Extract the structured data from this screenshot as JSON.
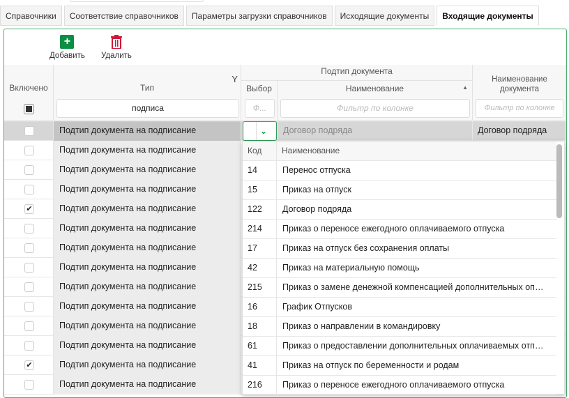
{
  "tabs": [
    "Справочники",
    "Соответствие справочников",
    "Параметры загрузки справочников",
    "Исходящие документы",
    "Входящие документы"
  ],
  "toolbar": {
    "add_label": "Добавить",
    "delete_label": "Удалить"
  },
  "colors": {
    "accent": "#0a8f43",
    "delete": "#d0193a",
    "border": "#4caf72"
  },
  "columns": {
    "enabled": "Включено",
    "type": "Тип",
    "subtype_group": "Подтип документа",
    "choice": "Выбор",
    "name": "Наименование",
    "doc_name": "Наименование документа"
  },
  "filters": {
    "type_value": "подписа",
    "choice_placeholder": "Ф...",
    "name_placeholder": "Фильтр по колонке",
    "doc_name_placeholder": "Фильтр по колонке"
  },
  "selected_row": {
    "type": "Подтип документа на подписание",
    "name": "Договор подряда",
    "doc_name": "Договор подряда"
  },
  "rows": [
    {
      "type": "Подтип документа на подписание",
      "checked": false
    },
    {
      "type": "Подтип документа на подписание",
      "checked": false
    },
    {
      "type": "Подтип документа на подписание",
      "checked": false
    },
    {
      "type": "Подтип документа на подписание",
      "checked": true
    },
    {
      "type": "Подтип документа на подписание",
      "checked": false
    },
    {
      "type": "Подтип документа на подписание",
      "checked": false
    },
    {
      "type": "Подтип документа на подписание",
      "checked": false
    },
    {
      "type": "Подтип документа на подписание",
      "checked": false
    },
    {
      "type": "Подтип документа на подписание",
      "checked": false
    },
    {
      "type": "Подтип документа на подписание",
      "checked": false
    },
    {
      "type": "Подтип документа на подписание",
      "checked": false
    },
    {
      "type": "Подтип документа на подписание",
      "checked": true
    },
    {
      "type": "Подтип документа на подписание",
      "checked": false
    }
  ],
  "dropdown": {
    "code_header": "Код",
    "name_header": "Наименование",
    "items": [
      {
        "code": "14",
        "name": "Перенос отпуска"
      },
      {
        "code": "15",
        "name": "Приказ на отпуск"
      },
      {
        "code": "122",
        "name": "Договор подряда"
      },
      {
        "code": "214",
        "name": "Приказ о переносе ежегодного оплачиваемого отпуска"
      },
      {
        "code": "17",
        "name": "Приказ на отпуск без сохранения оплаты"
      },
      {
        "code": "42",
        "name": "Приказ на материальную помощь"
      },
      {
        "code": "215",
        "name": "Приказ о замене денежной компенсацией дополнительных оплачиваемых отпусков"
      },
      {
        "code": "16",
        "name": "График Отпусков"
      },
      {
        "code": "18",
        "name": "Приказ о направлении в командировку"
      },
      {
        "code": "61",
        "name": "Приказ о предоставлении дополнительных оплачиваемых отпусков"
      },
      {
        "code": "41",
        "name": "Приказ на отпуск по беременности и родам"
      },
      {
        "code": "216",
        "name": "Приказ о переносе ежегодного оплачиваемого отпуска"
      }
    ]
  }
}
